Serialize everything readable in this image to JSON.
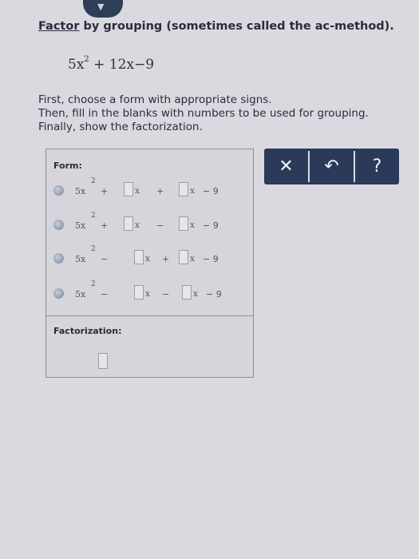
{
  "heading": {
    "link": "Factor",
    "rest": " by grouping (sometimes called the ac-method)."
  },
  "expression": {
    "lead": "5x",
    "exp": "2",
    "tail": " + 12x−9"
  },
  "instructions": [
    "First, choose a form with appropriate signs.",
    "Then, fill in the blanks with numbers to be used for grouping.",
    "Finally, show the factorization."
  ],
  "form": {
    "label": "Form:",
    "rows": [
      {
        "lead": "5x",
        "exp": "2",
        "op1": "+",
        "x1": "x",
        "op2": "+",
        "x2": "x",
        "tail": "− 9"
      },
      {
        "lead": "5x",
        "exp": "2",
        "op1": "+",
        "x1": "x",
        "op2": "−",
        "x2": "x",
        "tail": "− 9"
      },
      {
        "lead": "5x",
        "exp": "2",
        "op1": "−",
        "x1": "x",
        "op2": "+",
        "x2": "x",
        "tail": "− 9"
      },
      {
        "lead": "5x",
        "exp": "2",
        "op1": "−",
        "x1": "x",
        "op2": "−",
        "x2": "x",
        "tail": "− 9"
      }
    ]
  },
  "factorization": {
    "label": "Factorization:"
  },
  "toolbar": {
    "clear_glyph": "✕",
    "undo_glyph": "↶",
    "help_glyph": "?"
  },
  "colors": {
    "toolbar_bg": "#2a3a58",
    "page_bg": "#dad9df"
  }
}
